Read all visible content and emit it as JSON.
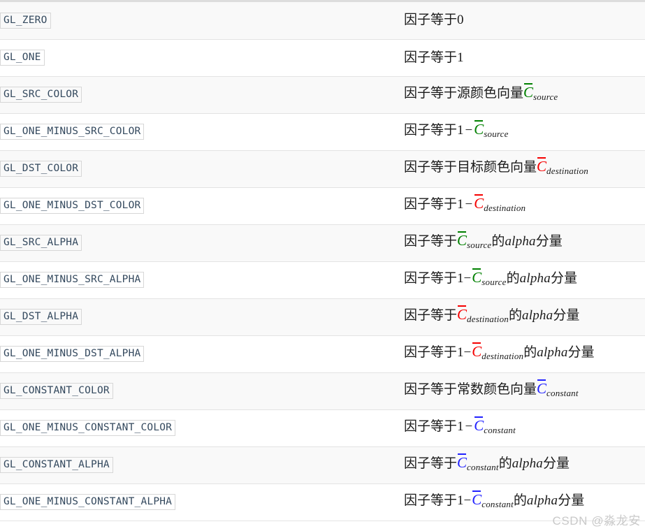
{
  "table": {
    "top_border_color": "#dddddd",
    "row_stripe_color": "#f9f9f9",
    "row_base_color": "#ffffff",
    "rows": [
      {
        "enum": "GL_ZERO",
        "desc_prefix": "因子等于",
        "desc_number": "0",
        "op": "",
        "vector": null,
        "vector_sub": null,
        "desc_suffix": ""
      },
      {
        "enum": "GL_ONE",
        "desc_prefix": "因子等于",
        "desc_number": "1",
        "op": "",
        "vector": null,
        "vector_sub": null,
        "desc_suffix": ""
      },
      {
        "enum": "GL_SRC_COLOR",
        "desc_prefix": "因子等于源颜色向量",
        "desc_number": "",
        "op": "",
        "vector": "C",
        "vector_sub": "source",
        "vector_color": "#008000",
        "desc_suffix": ""
      },
      {
        "enum": "GL_ONE_MINUS_SRC_COLOR",
        "desc_prefix": "因子等于",
        "desc_number": "1",
        "op": "−",
        "vector": "C",
        "vector_sub": "source",
        "vector_color": "#008000",
        "desc_suffix": ""
      },
      {
        "enum": "GL_DST_COLOR",
        "desc_prefix": "因子等于目标颜色向量",
        "desc_number": "",
        "op": "",
        "vector": "C",
        "vector_sub": "destination",
        "vector_color": "#f50000",
        "desc_suffix": ""
      },
      {
        "enum": "GL_ONE_MINUS_DST_COLOR",
        "desc_prefix": "因子等于",
        "desc_number": "1",
        "op": "−",
        "vector": "C",
        "vector_sub": "destination",
        "vector_color": "#f50000",
        "desc_suffix": ""
      },
      {
        "enum": "GL_SRC_ALPHA",
        "desc_prefix": "因子等于",
        "desc_number": "",
        "op": "",
        "vector": "C",
        "vector_sub": "source",
        "vector_color": "#008000",
        "desc_mid": "的",
        "desc_italic": "alpha",
        "desc_suffix": "分量"
      },
      {
        "enum": "GL_ONE_MINUS_SRC_ALPHA",
        "desc_prefix": "因子等于",
        "desc_number": "1",
        "op": "−",
        "vector": "C",
        "vector_sub": "source",
        "vector_color": "#008000",
        "desc_mid": "的",
        "desc_italic": "alpha",
        "desc_suffix": "分量"
      },
      {
        "enum": "GL_DST_ALPHA",
        "desc_prefix": "因子等于",
        "desc_number": "",
        "op": "",
        "vector": "C",
        "vector_sub": "destination",
        "vector_color": "#f50000",
        "desc_mid": "的",
        "desc_italic": "alpha",
        "desc_suffix": "分量"
      },
      {
        "enum": "GL_ONE_MINUS_DST_ALPHA",
        "desc_prefix": "因子等于",
        "desc_number": "1",
        "op": "−",
        "vector": "C",
        "vector_sub": "destination",
        "vector_color": "#f50000",
        "desc_mid": "的",
        "desc_italic": "alpha",
        "desc_suffix": "分量"
      },
      {
        "enum": "GL_CONSTANT_COLOR",
        "desc_prefix": "因子等于常数颜色向量",
        "desc_number": "",
        "op": "",
        "vector": "C",
        "vector_sub": "constant",
        "vector_color": "#2222ff",
        "desc_suffix": ""
      },
      {
        "enum": "GL_ONE_MINUS_CONSTANT_COLOR",
        "desc_prefix": "因子等于",
        "desc_number": "1",
        "op": "−",
        "vector": "C",
        "vector_sub": "constant",
        "vector_color": "#2222ff",
        "desc_suffix": ""
      },
      {
        "enum": "GL_CONSTANT_ALPHA",
        "desc_prefix": "因子等于",
        "desc_number": "",
        "op": "",
        "vector": "C",
        "vector_sub": "constant",
        "vector_color": "#2222ff",
        "desc_mid": "的",
        "desc_italic": "alpha",
        "desc_suffix": "分量"
      },
      {
        "enum": "GL_ONE_MINUS_CONSTANT_ALPHA",
        "desc_prefix": "因子等于",
        "desc_number": "1",
        "op": "−",
        "vector": "C",
        "vector_sub": "constant",
        "vector_color": "#2222ff",
        "desc_mid": "的",
        "desc_italic": "alpha",
        "desc_suffix": "分量"
      }
    ]
  },
  "watermark": {
    "text": "CSDN @淼龙安"
  }
}
